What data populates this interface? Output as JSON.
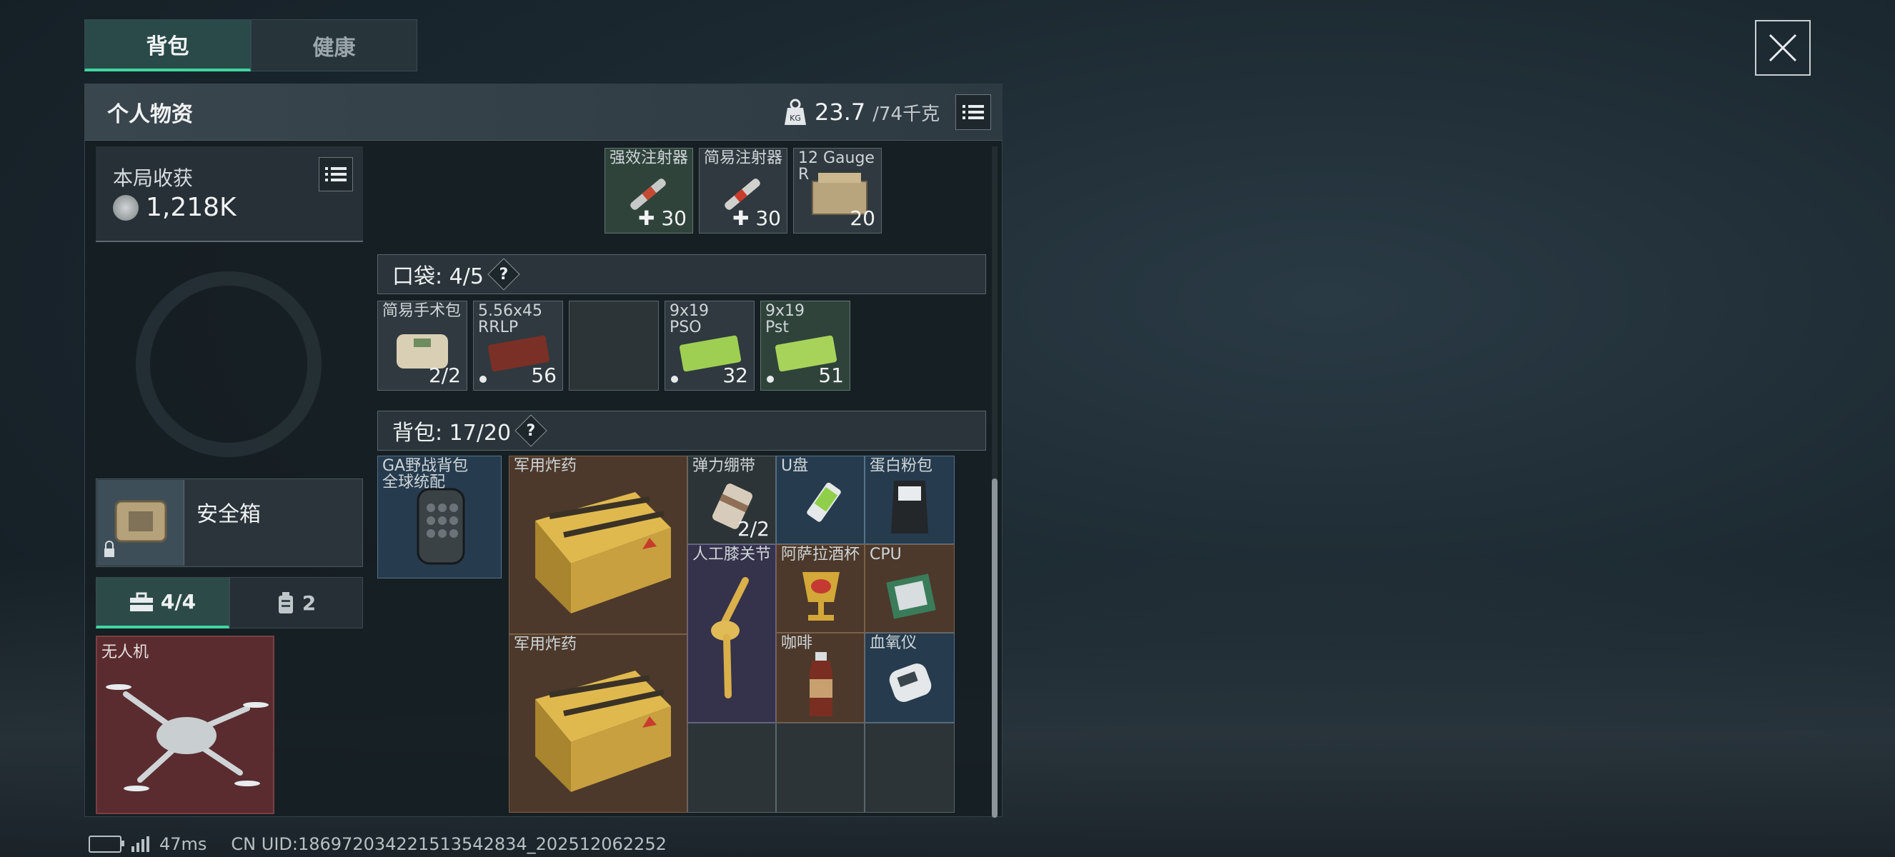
{
  "tabs": {
    "backpack": "背包",
    "health": "健康"
  },
  "header": {
    "title": "个人物资",
    "weight_current": "23.7",
    "weight_max": "/74千克"
  },
  "earnings": {
    "title": "本局收获",
    "value": "1,218K"
  },
  "safe": {
    "label": "安全箱"
  },
  "subtabs": {
    "tools": "4/4",
    "bottles": "2"
  },
  "drone": {
    "label": "无人机"
  },
  "top_items": [
    {
      "label": "强效注射器",
      "count": "30"
    },
    {
      "label": "简易注射器",
      "count": "30"
    },
    {
      "label": "12 Gauge\nR",
      "count": "20"
    }
  ],
  "pocket": {
    "title": "口袋: 4/5",
    "help": "?"
  },
  "pocket_items": [
    {
      "label": "简易手术包",
      "count": "2/2"
    },
    {
      "label": "5.56x45\nRRLP",
      "count": "56"
    },
    {
      "label": "",
      "count": ""
    },
    {
      "label": "9x19\nPSO",
      "count": "32"
    },
    {
      "label": "9x19\nPst",
      "count": "51"
    }
  ],
  "bag": {
    "title": "背包: 17/20",
    "help": "?"
  },
  "bag_container": {
    "label": "GA野战背包\n全球统配"
  },
  "bag_items": {
    "explosive1": "军用炸药",
    "explosive2": "军用炸药",
    "bandage": "弹力绷带",
    "bandage_count": "2/2",
    "usb": "U盘",
    "protein": "蛋白粉包",
    "knee": "人工膝关节",
    "cup": "阿萨拉酒杯",
    "cpu": "CPU",
    "coffee": "咖啡",
    "oximeter": "血氧仪"
  },
  "status": {
    "ping": "47ms",
    "uid": "CN UID:186972034221513542834_202512062252"
  }
}
